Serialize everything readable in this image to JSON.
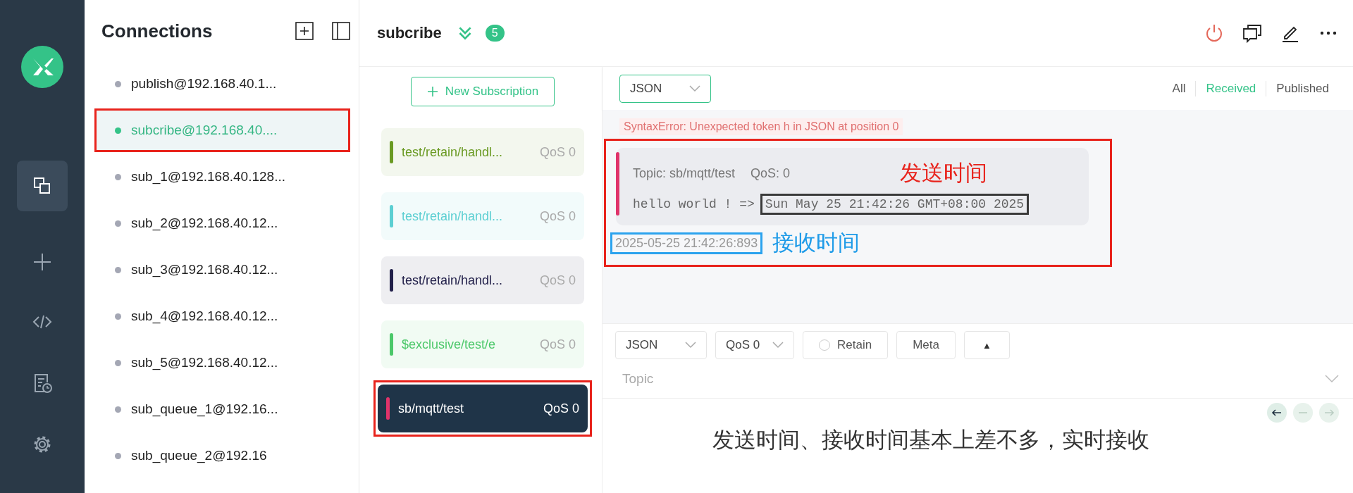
{
  "connections": {
    "title": "Connections",
    "items": [
      {
        "name": "publish@192.168.40.1...",
        "selected": false,
        "highlighted": false
      },
      {
        "name": "subcribe@192.168.40....",
        "selected": true,
        "highlighted": true
      },
      {
        "name": "sub_1@192.168.40.128...",
        "selected": false,
        "highlighted": false
      },
      {
        "name": "sub_2@192.168.40.12...",
        "selected": false,
        "highlighted": false
      },
      {
        "name": "sub_3@192.168.40.12...",
        "selected": false,
        "highlighted": false
      },
      {
        "name": "sub_4@192.168.40.12...",
        "selected": false,
        "highlighted": false
      },
      {
        "name": "sub_5@192.168.40.12...",
        "selected": false,
        "highlighted": false
      },
      {
        "name": "sub_queue_1@192.16...",
        "selected": false,
        "highlighted": false
      },
      {
        "name": "sub_queue_2@192.16",
        "selected": false,
        "highlighted": false
      }
    ]
  },
  "header": {
    "title": "subcribe",
    "count": "5"
  },
  "subscriptions": {
    "new_button": "New Subscription",
    "items": [
      {
        "topic": "test/retain/handl...",
        "qos": "QoS 0",
        "color": "#6a9a23",
        "selected": false,
        "highlighted": false
      },
      {
        "topic": "test/retain/handl...",
        "qos": "QoS 0",
        "color": "#5ccfd2",
        "selected": false,
        "highlighted": false
      },
      {
        "topic": "test/retain/handl...",
        "qos": "QoS 0",
        "color": "#22204a",
        "selected": false,
        "highlighted": false
      },
      {
        "topic": "$exclusive/test/e",
        "qos": "QoS 0",
        "color": "#4cc86a",
        "selected": false,
        "highlighted": false
      },
      {
        "topic": "sb/mqtt/test",
        "qos": "QoS 0",
        "color": "#e0336a",
        "selected": true,
        "highlighted": true
      }
    ]
  },
  "toolbar": {
    "format": "JSON",
    "filters": [
      {
        "label": "All",
        "selected": false
      },
      {
        "label": "Received",
        "selected": true
      },
      {
        "label": "Published",
        "selected": false
      }
    ]
  },
  "messages": {
    "error": "SyntaxError: Unexpected token h in JSON at position 0",
    "items": [
      {
        "topic": "Topic: sb/mqtt/test",
        "qos": "QoS: 0",
        "payload": "hello world ! =>",
        "send_time": "Sun May 25 21:42:26 GMT+08:00 2025",
        "time": "2025-05-25 21:42:26:893",
        "color": "#e0336a",
        "highlighted": true,
        "send_note": "发送时间",
        "receive_note": "接收时间"
      }
    ]
  },
  "compose": {
    "format": "JSON",
    "qos": "QoS 0",
    "retain": {
      "label": "Retain",
      "checked": false
    },
    "meta": "Meta",
    "expand": "▲",
    "topic_placeholder": "Topic",
    "payload": "发送时间、接收时间基本上差不多，实时接收"
  }
}
